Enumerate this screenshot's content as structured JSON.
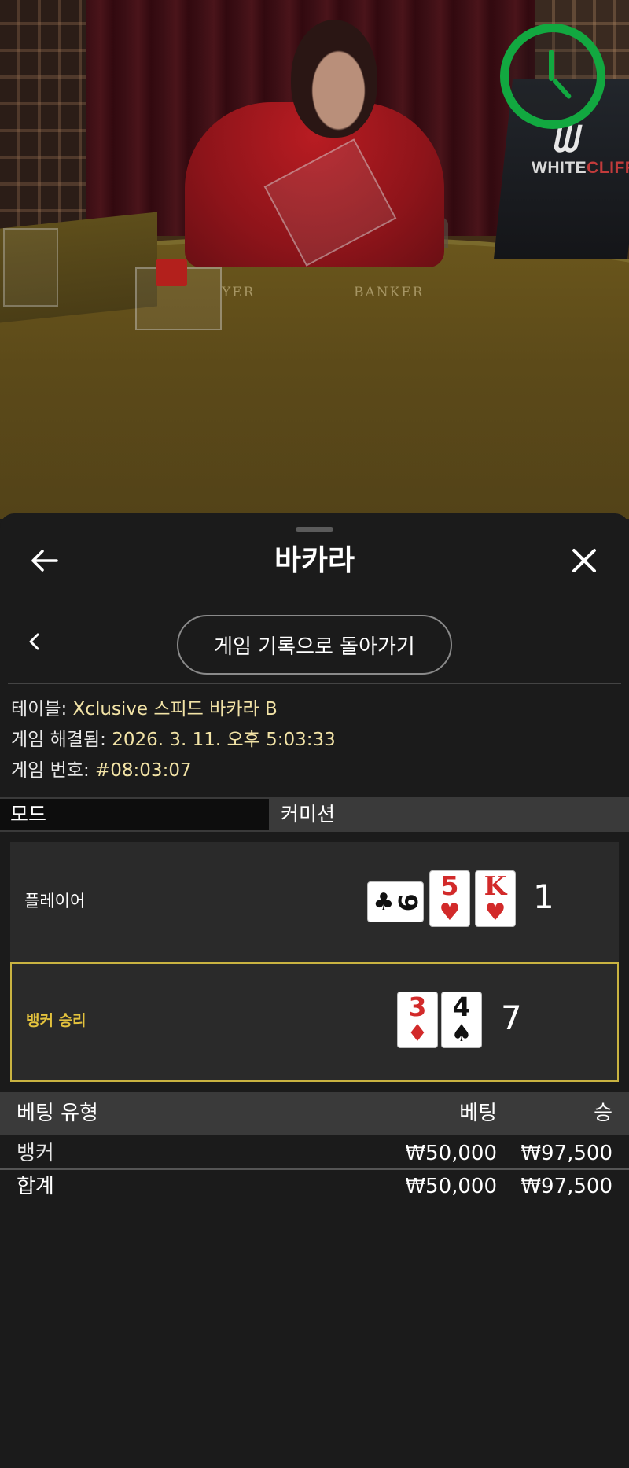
{
  "video": {
    "felt_labels": [
      "YER",
      "BANKER"
    ],
    "brand_logo": {
      "name": "WHITECLIFF",
      "part1": "WHITE",
      "part2": "CLIFF",
      "accent_color": "#c23b3b"
    },
    "timer": {
      "icon": "clock-icon",
      "color": "#12a840"
    }
  },
  "sheet": {
    "title": "바카라",
    "back_icon": "arrow-left-icon",
    "close_icon": "close-icon",
    "sub_back_icon": "chevron-left-icon",
    "history_button_label": "게임 기록으로 돌아가기",
    "info": [
      {
        "label": "테이블:",
        "value": "Xclusive 스피드 바카라 B"
      },
      {
        "label": "게임 해결됨:",
        "value": "2026. 3. 11. 오후 5:03:33"
      },
      {
        "label": "게임 번호:",
        "value": "#08:03:07"
      }
    ],
    "tabs": {
      "mode": "모드",
      "commission": "커미션"
    }
  },
  "hands": {
    "player": {
      "label": "플레이어",
      "score": "1",
      "cards": [
        {
          "rank": "9",
          "suit": "♣",
          "color": "black",
          "orientation": "sideways"
        },
        {
          "rank": "5",
          "suit": "♥",
          "color": "red"
        },
        {
          "rank": "K",
          "suit": "♥",
          "color": "red"
        }
      ]
    },
    "banker": {
      "label": "뱅커 승리",
      "score": "7",
      "highlight_color": "#c9b341",
      "cards": [
        {
          "rank": "3",
          "suit": "♦",
          "color": "red"
        },
        {
          "rank": "4",
          "suit": "♠",
          "color": "black"
        }
      ]
    }
  },
  "bets": {
    "headers": {
      "type": "베팅 유형",
      "bet": "베팅",
      "win": "승"
    },
    "rows": [
      {
        "type": "뱅커",
        "bet": "₩50,000",
        "win": "₩97,500"
      }
    ],
    "total": {
      "type": "합계",
      "bet": "₩50,000",
      "win": "₩97,500"
    }
  }
}
